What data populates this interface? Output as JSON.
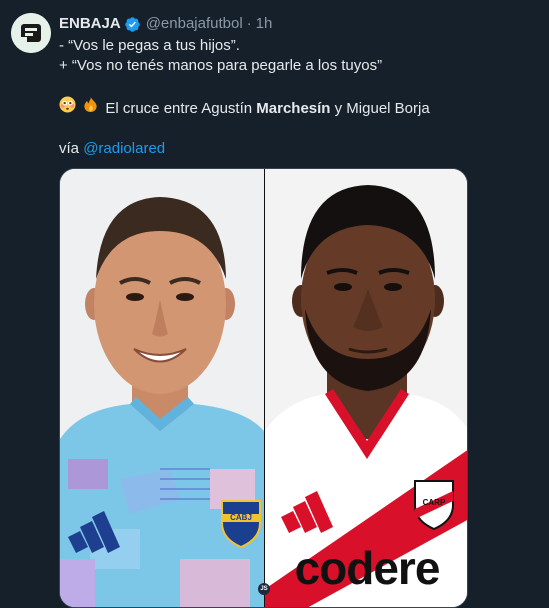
{
  "tweet": {
    "display_name": "ENBAJA",
    "handle": "@enbajafutbol",
    "separator": "·",
    "time": "1h",
    "line1": "- “Vos le pegas a tus hijos”.",
    "line2": "+ “Vos no tenés manos para pegarle a los tuyos”",
    "line3_prefix": "El cruce entre Agustín ",
    "line3_bold": "Marchesín",
    "line3_suffix": " y Miguel Borja",
    "via_prefix": "vía ",
    "via_link": "@radiolared"
  },
  "media": {
    "badge_text": "JS",
    "left_crest_text": "CABJ",
    "right_crest_text": "CARP",
    "sponsor_text": "codere"
  },
  "colors": {
    "background": "#15202b",
    "link": "#1d9bf0",
    "verified": "#1d9bf0",
    "muted": "#8b98a5"
  },
  "icons": {
    "avatar": "enbaja-logo",
    "verified": "verified-badge-icon",
    "emoji1": "flushed-face-emoji",
    "emoji2": "fire-emoji"
  }
}
